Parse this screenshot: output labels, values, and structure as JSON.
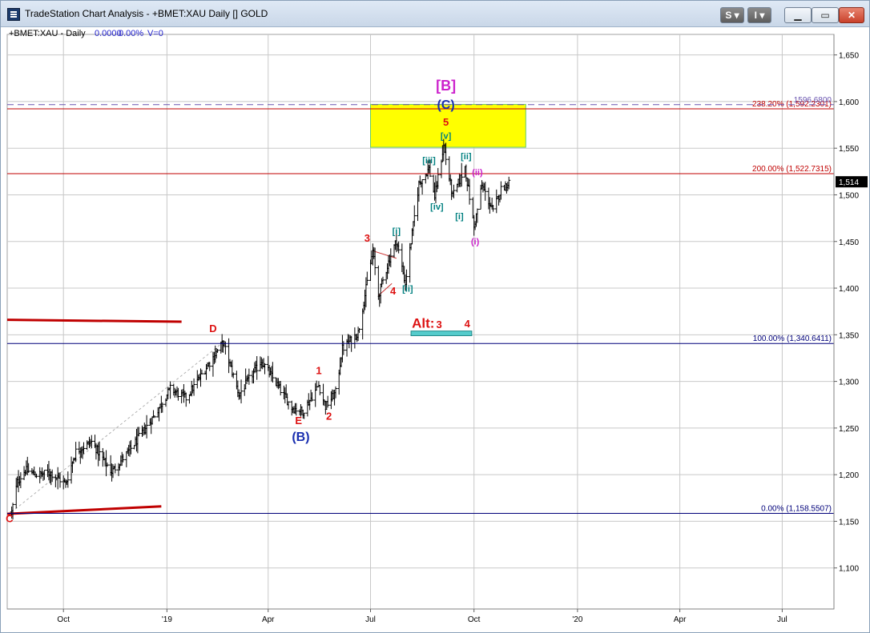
{
  "window": {
    "title": "TradeStation Chart Analysis - +BMET:XAU Daily [] GOLD",
    "buttons": {
      "s": "S",
      "i": "I",
      "minimize": "",
      "maximize": "",
      "close": "✕"
    }
  },
  "chart_data": {
    "type": "bar",
    "symbol_label": "+BMET:XAU - Daily",
    "change_value": "0.0000",
    "change_pct": "0.00%",
    "volume_label": "V=0",
    "last_price_label": "1,514",
    "x_ticks": [
      "Oct",
      "'19",
      "Apr",
      "Jul",
      "Oct",
      "'20",
      "Apr",
      "Jul"
    ],
    "x_tick_dates": [
      "2018-10-01",
      "2019-01-01",
      "2019-04-01",
      "2019-07-01",
      "2019-10-01",
      "2020-01-01",
      "2020-04-01",
      "2020-07-01"
    ],
    "x_range": [
      "2018-08-12",
      "2020-08-16"
    ],
    "y_ticks": [
      "1,650",
      "1,600",
      "1,550",
      "1,500",
      "1,450",
      "1,400",
      "1,350",
      "1,300",
      "1,250",
      "1,200",
      "1,150",
      "1,100"
    ],
    "y_tick_values": [
      1650,
      1600,
      1550,
      1500,
      1450,
      1400,
      1350,
      1300,
      1250,
      1200,
      1150,
      1100
    ],
    "ylim": [
      1056,
      1672
    ],
    "grid": true,
    "colors": {
      "bars": "#000000",
      "fib_red": "#c00000",
      "fib_blue": "#00007a",
      "wave_red": "#dd1111",
      "wave_blue": "#1a2fb0",
      "wave_magenta": "#cc22cc",
      "wave_teal": "#008080",
      "target_box": "#ffff00",
      "alt_box": "#55cccc",
      "grid": "#c8c8c8"
    },
    "price_keyframes": [
      {
        "date": "2018-08-16",
        "price": 1160
      },
      {
        "date": "2018-08-21",
        "price": 1192
      },
      {
        "date": "2018-08-28",
        "price": 1205
      },
      {
        "date": "2018-09-06",
        "price": 1200
      },
      {
        "date": "2018-09-20",
        "price": 1202
      },
      {
        "date": "2018-10-03",
        "price": 1190
      },
      {
        "date": "2018-10-12",
        "price": 1225
      },
      {
        "date": "2018-10-26",
        "price": 1235
      },
      {
        "date": "2018-11-13",
        "price": 1203
      },
      {
        "date": "2018-11-30",
        "price": 1228
      },
      {
        "date": "2018-12-20",
        "price": 1262
      },
      {
        "date": "2019-01-04",
        "price": 1292
      },
      {
        "date": "2019-01-18",
        "price": 1282
      },
      {
        "date": "2019-02-20",
        "price": 1342
      },
      {
        "date": "2019-03-06",
        "price": 1286
      },
      {
        "date": "2019-03-26",
        "price": 1322
      },
      {
        "date": "2019-04-22",
        "price": 1272
      },
      {
        "date": "2019-05-02",
        "price": 1268
      },
      {
        "date": "2019-05-16",
        "price": 1296
      },
      {
        "date": "2019-05-22",
        "price": 1273
      },
      {
        "date": "2019-05-31",
        "price": 1288
      },
      {
        "date": "2019-06-06",
        "price": 1335
      },
      {
        "date": "2019-06-20",
        "price": 1352
      },
      {
        "date": "2019-07-03",
        "price": 1440
      },
      {
        "date": "2019-07-08",
        "price": 1392
      },
      {
        "date": "2019-07-18",
        "price": 1432
      },
      {
        "date": "2019-07-24",
        "price": 1451
      },
      {
        "date": "2019-08-01",
        "price": 1405
      },
      {
        "date": "2019-08-13",
        "price": 1512
      },
      {
        "date": "2019-08-22",
        "price": 1528
      },
      {
        "date": "2019-08-27",
        "price": 1498
      },
      {
        "date": "2019-09-04",
        "price": 1552
      },
      {
        "date": "2019-09-12",
        "price": 1498
      },
      {
        "date": "2019-09-23",
        "price": 1530
      },
      {
        "date": "2019-10-01",
        "price": 1465
      },
      {
        "date": "2019-10-08",
        "price": 1510
      },
      {
        "date": "2019-10-18",
        "price": 1482
      },
      {
        "date": "2019-10-25",
        "price": 1506
      },
      {
        "date": "2019-11-01",
        "price": 1514
      }
    ],
    "fib_levels": [
      {
        "label": "238.20% (1,592.2301)",
        "price": 1592.23,
        "color": "#c00000"
      },
      {
        "label": "200.00% (1,522.7315)",
        "price": 1522.73,
        "color": "#c00000"
      },
      {
        "label": "100.00% (1,340.6411)",
        "price": 1340.64,
        "color": "#00007a"
      },
      {
        "label": "0.00% (1,158.5507)",
        "price": 1158.55,
        "color": "#00007a"
      }
    ],
    "dashed_level": {
      "label": "1596.6800",
      "price": 1596.68
    },
    "target_box": {
      "date_from": "2019-07-01",
      "date_to": "2019-11-16",
      "price_from": 1551,
      "price_to": 1597
    },
    "alt_box": {
      "label": "Alt:",
      "date_from": "2019-08-06",
      "date_to": "2019-09-29",
      "price_from": 1349,
      "price_to": 1354
    },
    "thick_red_lines": [
      {
        "date_from": "2018-08-12",
        "price_from": 1366,
        "date_to": "2019-01-14",
        "price_to": 1364
      },
      {
        "date_from": "2018-08-12",
        "price_from": 1158,
        "date_to": "2018-12-27",
        "price_to": 1166
      }
    ],
    "wave_labels": [
      {
        "text": "[B]",
        "date": "2019-09-06",
        "price": 1612,
        "color": "#cc22cc",
        "size": 18
      },
      {
        "text": "(C)",
        "date": "2019-09-06",
        "price": 1592,
        "color": "#1a2fb0",
        "size": 16
      },
      {
        "text": "5",
        "date": "2019-09-06",
        "price": 1574,
        "color": "#dd1111",
        "size": 13
      },
      {
        "text": "[v]",
        "date": "2019-09-06",
        "price": 1560,
        "color": "#008080",
        "size": 11
      },
      {
        "text": "[iii]",
        "date": "2019-08-22",
        "price": 1534,
        "color": "#008080",
        "size": 11
      },
      {
        "text": "[ii]",
        "date": "2019-09-24",
        "price": 1538,
        "color": "#008080",
        "size": 11
      },
      {
        "text": "(ii)",
        "date": "2019-10-04",
        "price": 1521,
        "color": "#cc22cc",
        "size": 11
      },
      {
        "text": "[iv]",
        "date": "2019-08-29",
        "price": 1484,
        "color": "#008080",
        "size": 11
      },
      {
        "text": "[i]",
        "date": "2019-09-18",
        "price": 1474,
        "color": "#008080",
        "size": 11
      },
      {
        "text": "(i)",
        "date": "2019-10-02",
        "price": 1447,
        "color": "#cc22cc",
        "size": 11
      },
      {
        "text": "[i]",
        "date": "2019-07-24",
        "price": 1458,
        "color": "#008080",
        "size": 11
      },
      {
        "text": "3",
        "date": "2019-06-28",
        "price": 1450,
        "color": "#dd1111",
        "size": 13
      },
      {
        "text": "4",
        "date": "2019-07-21",
        "price": 1393,
        "color": "#dd1111",
        "size": 13
      },
      {
        "text": "[ii]",
        "date": "2019-08-03",
        "price": 1396,
        "color": "#008080",
        "size": 11
      },
      {
        "text": "3",
        "date": "2019-08-31",
        "price": 1357,
        "color": "#dd1111",
        "size": 13
      },
      {
        "text": "4",
        "date": "2019-09-25",
        "price": 1358,
        "color": "#dd1111",
        "size": 13
      },
      {
        "text": "D",
        "date": "2019-02-11",
        "price": 1353,
        "color": "#dd1111",
        "size": 13
      },
      {
        "text": "1",
        "date": "2019-05-16",
        "price": 1308,
        "color": "#dd1111",
        "size": 13
      },
      {
        "text": "2",
        "date": "2019-05-25",
        "price": 1259,
        "color": "#dd1111",
        "size": 13
      },
      {
        "text": "E",
        "date": "2019-04-28",
        "price": 1254,
        "color": "#dd1111",
        "size": 13
      },
      {
        "text": "(B)",
        "date": "2019-04-30",
        "price": 1236,
        "color": "#1a2fb0",
        "size": 16
      },
      {
        "text": "C",
        "date": "2018-08-14",
        "price": 1149,
        "color": "#dd1111",
        "size": 13
      }
    ]
  }
}
